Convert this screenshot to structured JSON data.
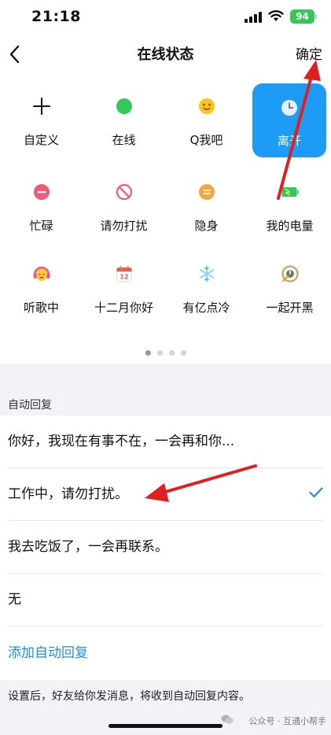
{
  "status_bar": {
    "time": "21:18",
    "battery": "94"
  },
  "nav": {
    "title": "在线状态",
    "confirm_label": "确定",
    "back_icon": "chevron-left-icon"
  },
  "statuses": [
    {
      "label": "自定义",
      "icon": "plus-icon"
    },
    {
      "label": "在线",
      "icon": "online-dot-icon",
      "color": "#34c759"
    },
    {
      "label": "Q我吧",
      "icon": "smiley-icon",
      "color": "#ffc21a"
    },
    {
      "label": "离开",
      "icon": "clock-icon",
      "selected": true
    },
    {
      "label": "忙碌",
      "icon": "busy-icon",
      "color": "#f05a78"
    },
    {
      "label": "请勿打扰",
      "icon": "do-not-disturb-icon",
      "color": "#f05a78"
    },
    {
      "label": "隐身",
      "icon": "invisible-icon",
      "color": "#f7a53a"
    },
    {
      "label": "我的电量",
      "icon": "battery-icon",
      "color": "#34c759"
    },
    {
      "label": "听歌中",
      "icon": "headphones-icon",
      "color": "#f0558a"
    },
    {
      "label": "十二月你好",
      "icon": "calendar-icon",
      "color": "#f0584a"
    },
    {
      "label": "有亿点冷",
      "icon": "snowflake-icon",
      "color": "#8fd4f2"
    },
    {
      "label": "一起开黑",
      "icon": "game-icon",
      "color": "#c7a063"
    }
  ],
  "pagination": {
    "pages": 4,
    "current": 1
  },
  "auto_reply": {
    "section_title": "自动回复",
    "options": [
      {
        "text": "你好，我现在有事不在，一会再和你..."
      },
      {
        "text": "工作中，请勿打扰。",
        "selected": true
      },
      {
        "text": "我去吃饭了，一会再联系。"
      },
      {
        "text": "无"
      }
    ],
    "add_label": "添加自动回复"
  },
  "footer_note": "设置后，好友给你发消息，将收到自动回复内容。",
  "watermark": "公众号 · 互通小帮手"
}
